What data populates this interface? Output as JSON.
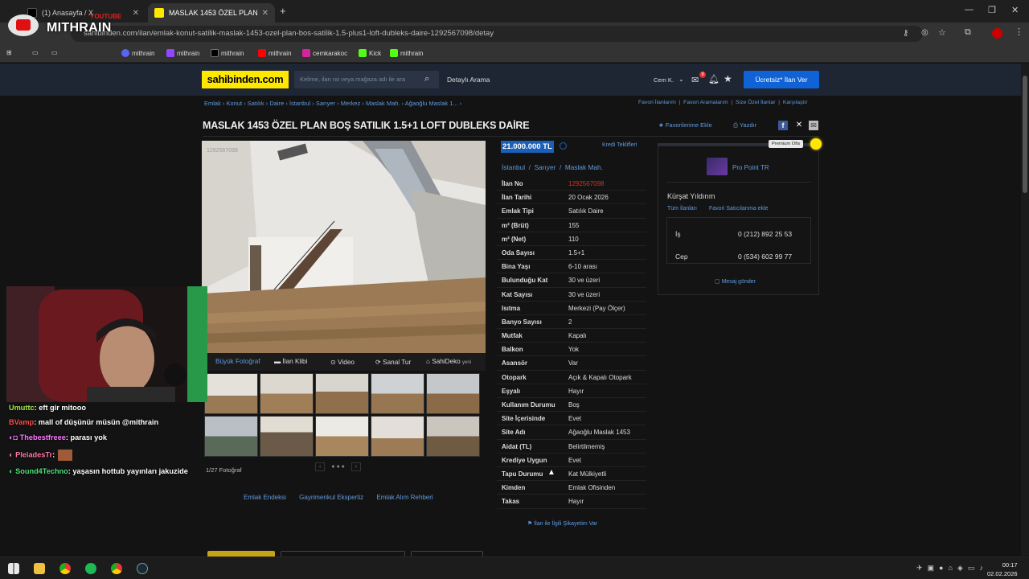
{
  "browser": {
    "tabs": [
      {
        "label": "(1) Anasayfa / X"
      },
      {
        "label": "MASLAK 1453 ÖZEL PLAN BOŞ SATILIK 1.5+1 LOFT DUBLEKS DAİRE"
      }
    ],
    "new_tab": "+",
    "url": "sahibinden.com/ilan/emlak-konut-satilik-maslak-1453-ozel-plan-bos-satilik-1.5-plus1-loft-dubleks-daire-1292567098/detay",
    "overlay_logo": "MITHRAIN",
    "overlay_small": "YOUTUBE",
    "bookmarks": [
      "mithrain",
      "mithrain",
      "mithrain",
      "mithrain",
      "cemkarakoc",
      "Kick",
      "mithrain"
    ]
  },
  "header": {
    "logo": "sahibinden.com",
    "search_placeholder": "Kelime, ilan no veya mağaza adı ile ara",
    "advanced_search": "Detaylı Arama",
    "user": "Cem K.",
    "mail_badge": "9",
    "free_ad": "Ücretsiz* İlan Ver"
  },
  "breadcrumbs": [
    "Emlak",
    "Konut",
    "Satılık",
    "Daire",
    "İstanbul",
    "Sarıyer",
    "Merkez",
    "Maslak Mah.",
    "Ağaoğlu Maslak 1..."
  ],
  "top_links": [
    "Favori İlanlarım",
    "Favori Aramalarım",
    "Size Özel İlanlar",
    "Karşılaştır"
  ],
  "listing": {
    "title": "MASLAK 1453 ÖZEL PLAN BOŞ SATILIK 1.5+1 LOFT DUBLEKS DAİRE",
    "favorite": "Favorilerime Ekle",
    "print": "Yazdır",
    "photo_watermark": "1292567098",
    "price": "21.000.000 TL",
    "loan_offers": "Kredi Teklifleri",
    "location": [
      "İstanbul",
      "Sarıyer",
      "Maslak Mah."
    ],
    "photo_tabs": [
      "Büyük Fotoğraf",
      "İlan Klibi",
      "Video",
      "Sanal Tur",
      "SahiDeko"
    ],
    "new_badge": "yeni",
    "photo_count": "1/27 Fotoğraf",
    "details": [
      {
        "k": "İlan No",
        "v": "1292567098",
        "red": true
      },
      {
        "k": "İlan Tarihi",
        "v": "20 Ocak 2026"
      },
      {
        "k": "Emlak Tipi",
        "v": "Satılık Daire"
      },
      {
        "k": "m² (Brüt)",
        "v": "155"
      },
      {
        "k": "m² (Net)",
        "v": "110"
      },
      {
        "k": "Oda Sayısı",
        "v": "1.5+1"
      },
      {
        "k": "Bina Yaşı",
        "v": "6-10 arası"
      },
      {
        "k": "Bulunduğu Kat",
        "v": "30 ve üzeri"
      },
      {
        "k": "Kat Sayısı",
        "v": "30 ve üzeri"
      },
      {
        "k": "Isıtma",
        "v": "Merkezi (Pay Ölçer)"
      },
      {
        "k": "Banyo Sayısı",
        "v": "2"
      },
      {
        "k": "Mutfak",
        "v": "Kapalı"
      },
      {
        "k": "Balkon",
        "v": "Yok"
      },
      {
        "k": "Asansör",
        "v": "Var"
      },
      {
        "k": "Otopark",
        "v": "Açık & Kapalı Otopark"
      },
      {
        "k": "Eşyalı",
        "v": "Hayır"
      },
      {
        "k": "Kullanım Durumu",
        "v": "Boş"
      },
      {
        "k": "Site İçerisinde",
        "v": "Evet"
      },
      {
        "k": "Site Adı",
        "v": "Ağaoğlu Maslak 1453"
      },
      {
        "k": "Aidat (TL)",
        "v": "Belirtilmemiş"
      },
      {
        "k": "Krediye Uygun",
        "v": "Evet"
      },
      {
        "k": "Tapu Durumu",
        "v": "Kat Mülkiyetli"
      },
      {
        "k": "Kimden",
        "v": "Emlak Ofisinden"
      },
      {
        "k": "Takas",
        "v": "Hayır"
      }
    ],
    "complaint": "İlan ile İlgili Şikayetim Var",
    "bottom_links": [
      "Emlak Endeksi",
      "Gayrimenkul Ekspertiz",
      "Emlak Alım Rehberi"
    ]
  },
  "seller": {
    "badge": "Premium Ofis",
    "office": "Pro Point TR",
    "agent": "Kürşat Yıldırım",
    "all_ads": "Tüm İlanları",
    "fav_seller": "Favori Satıcılarıma ekle",
    "work_label": "İş",
    "work_phone": "0 (212) 892 25 53",
    "mobile_label": "Cep",
    "mobile_phone": "0 (534) 602 99 77",
    "message": "Mesaj gönder"
  },
  "chat": [
    {
      "user": "Umuttc",
      "text": ": eft gir mitooo",
      "color": "#a7e34a"
    },
    {
      "user": "BVamp",
      "text": ": mall of düşünür müsün @mithrain",
      "color": "#ff4d4d"
    },
    {
      "user": "Thebestfreee",
      "text": ": parası yok",
      "color": "#ff77ff"
    },
    {
      "user": "PleiadesTr",
      "text": ":",
      "color": "#ff77aa"
    },
    {
      "user": "Sound4Techno",
      "text": ": yaşasın hottub yayınları jakuzide",
      "color": "#4de07a"
    }
  ],
  "taskbar": {
    "time": "00:17",
    "date": "02.02.2026"
  }
}
